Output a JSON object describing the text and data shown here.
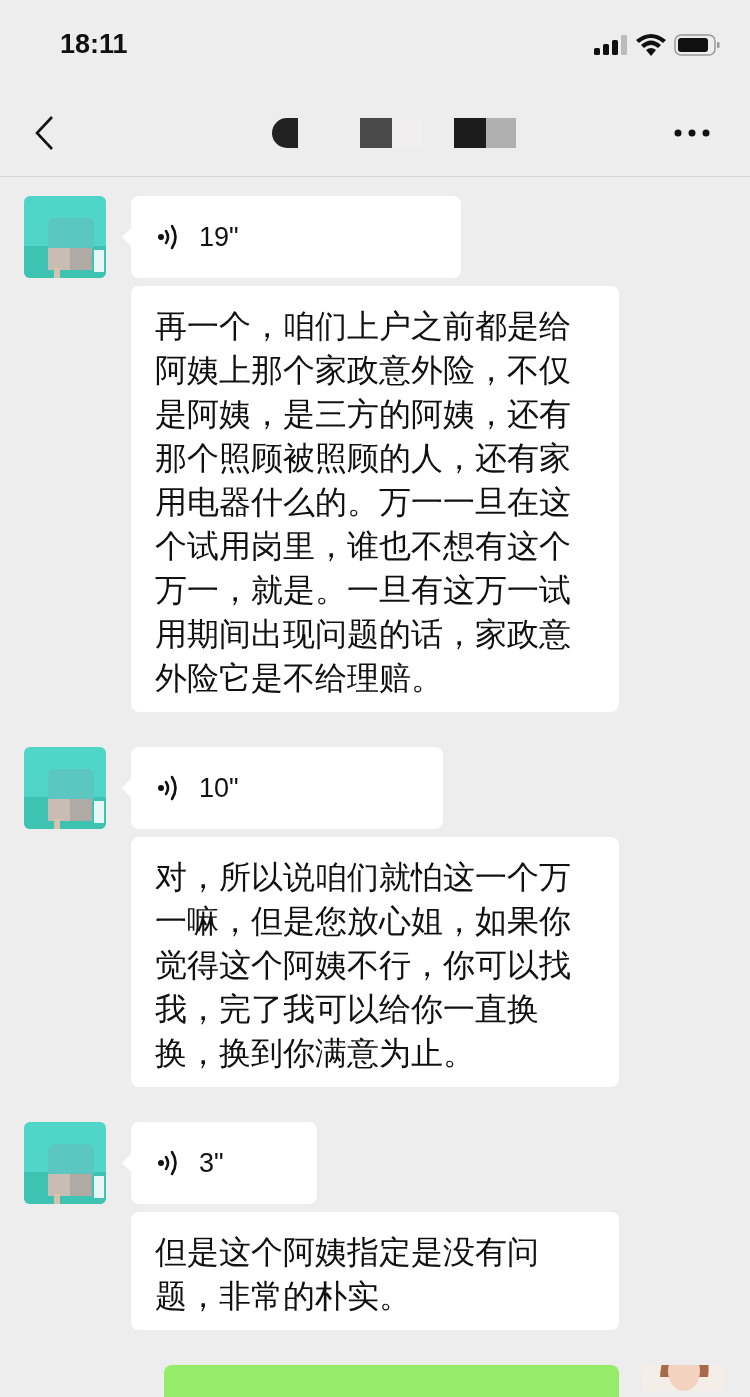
{
  "status_bar": {
    "time": "18:11"
  },
  "messages": [
    {
      "kind": "voice",
      "duration": "19\""
    },
    {
      "kind": "text",
      "text": "再一个，咱们上户之前都是给阿姨上那个家政意外险，不仅是阿姨，是三方的阿姨，还有那个照顾被照顾的人，还有家用电器什么的。万一一旦在这个试用岗里，谁也不想有这个万一，就是。一旦有这万一试用期间出现问题的话，家政意外险它是不给理赔。"
    },
    {
      "kind": "voice",
      "duration": "10\""
    },
    {
      "kind": "text",
      "text": "对，所以说咱们就怕这一个万一嘛，但是您放心姐，如果你觉得这个阿姨不行，你可以找我，完了我可以给你一直换换，换到你满意为止。"
    },
    {
      "kind": "voice",
      "duration": "3\""
    },
    {
      "kind": "text",
      "text": "但是这个阿姨指定是没有问题，非常的朴实。"
    },
    {
      "kind": "outgoing"
    }
  ]
}
